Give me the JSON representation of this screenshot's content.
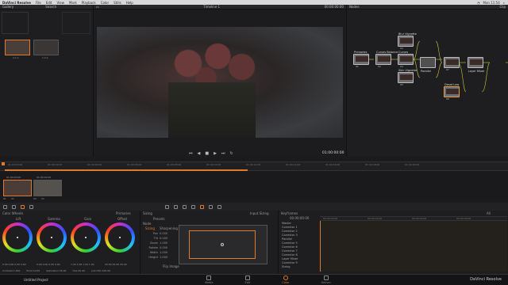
{
  "menubar": {
    "app_name": "DaVinci Resolve",
    "items": [
      "File",
      "Edit",
      "View",
      "Mark",
      "Playback",
      "Color",
      "Stills",
      "Help"
    ],
    "clock": "Mon 11:54"
  },
  "gallery": {
    "title": "Gallery",
    "search_label": "Search",
    "still_labels": [
      "1.1.1",
      "1.2.1"
    ]
  },
  "viewer": {
    "timeline_name": "Timeline 1",
    "timecode_top": "00:00:00:00",
    "timecode": "01:00:00:00"
  },
  "nodes": {
    "title": "Nodes",
    "clip_label": "Clip",
    "items": [
      {
        "label": "Primaries",
        "num": "01"
      },
      {
        "label": "Curves Balance",
        "num": "02"
      },
      {
        "label": "Blur Vignette",
        "num": "03"
      },
      {
        "label": "Curves",
        "num": "04"
      },
      {
        "label": "Skin Vignette",
        "num": "05"
      },
      {
        "label": "Parallel",
        "num": ""
      },
      {
        "label": "",
        "num": "07"
      },
      {
        "label": "Layer Mixer",
        "num": ""
      },
      {
        "label": "Desat Low",
        "num": "08"
      }
    ]
  },
  "timeline": {
    "ticks": [
      "01:00:00:00",
      "01:00:02:00",
      "01:00:04:00",
      "01:00:06:00",
      "01:00:08:00",
      "01:00:10:00",
      "01:00:12:00",
      "01:00:14:00",
      "01:00:16:00",
      "01:00:18:00",
      "01:00:20:00"
    ],
    "clip_timecodes": [
      "01:00:00:00",
      "01:00:02:00"
    ],
    "clip_labels": [
      "01",
      "02"
    ],
    "clip_track": [
      "V1",
      "V1"
    ]
  },
  "color_wheels": {
    "title": "Color Wheels",
    "mode": "Primaries",
    "wheels": [
      {
        "name": "Lift",
        "values": "0.00  0.00  0.00  0.00"
      },
      {
        "name": "Gamma",
        "values": "0.00  0.00  0.00  0.00"
      },
      {
        "name": "Gain",
        "values": "1.00  1.00  1.00  1.00"
      },
      {
        "name": "Offset",
        "values": "25.00  25.00  25.00"
      }
    ],
    "footer": {
      "contrast": "Contrast 1.000",
      "pivot": "Pivot 0.435",
      "saturation": "Saturation 50.00",
      "hue": "Hue 50.00",
      "lum_mix": "Lum Mix 100.00"
    }
  },
  "sizing": {
    "title": "Sizing",
    "presets_label": "Presets",
    "input_label": "Input Sizing",
    "node_label": "Node",
    "sizing_button": "Sizing",
    "sharpening_label": "Sharpening",
    "fields": [
      {
        "name": "Pan",
        "value": "0.000"
      },
      {
        "name": "Tilt",
        "value": "0.000"
      },
      {
        "name": "Zoom",
        "value": "1.000"
      },
      {
        "name": "Rotate",
        "value": "0.000"
      },
      {
        "name": "Width",
        "value": "1.000"
      },
      {
        "name": "Height",
        "value": "1.000"
      }
    ],
    "flip_label": "Flip Image"
  },
  "keyframes": {
    "title": "Keyframes",
    "timecode": "00:00:00:00",
    "all_label": "All",
    "rows": [
      "Master",
      "Corrector 1",
      "Corrector 2",
      "Corrector 3",
      "Parallel",
      "Corrector 5",
      "Corrector 6",
      "Corrector 7",
      "Corrector 8",
      "Layer Mixer",
      "Corrector 9",
      "Sizing"
    ],
    "ticks": [
      "00:00:00:00",
      "00:00:02:00",
      "00:00:04:00",
      "00:00:06:00"
    ]
  },
  "footer": {
    "project": "Untitled Project",
    "brand": "DaVinci Resolve",
    "tabs": [
      "Media",
      "Edit",
      "Color",
      "Deliver"
    ],
    "active_tab": 2
  },
  "colors": {
    "accent": "#e07a2c",
    "background": "#1b1b1d",
    "panel": "#232325"
  }
}
